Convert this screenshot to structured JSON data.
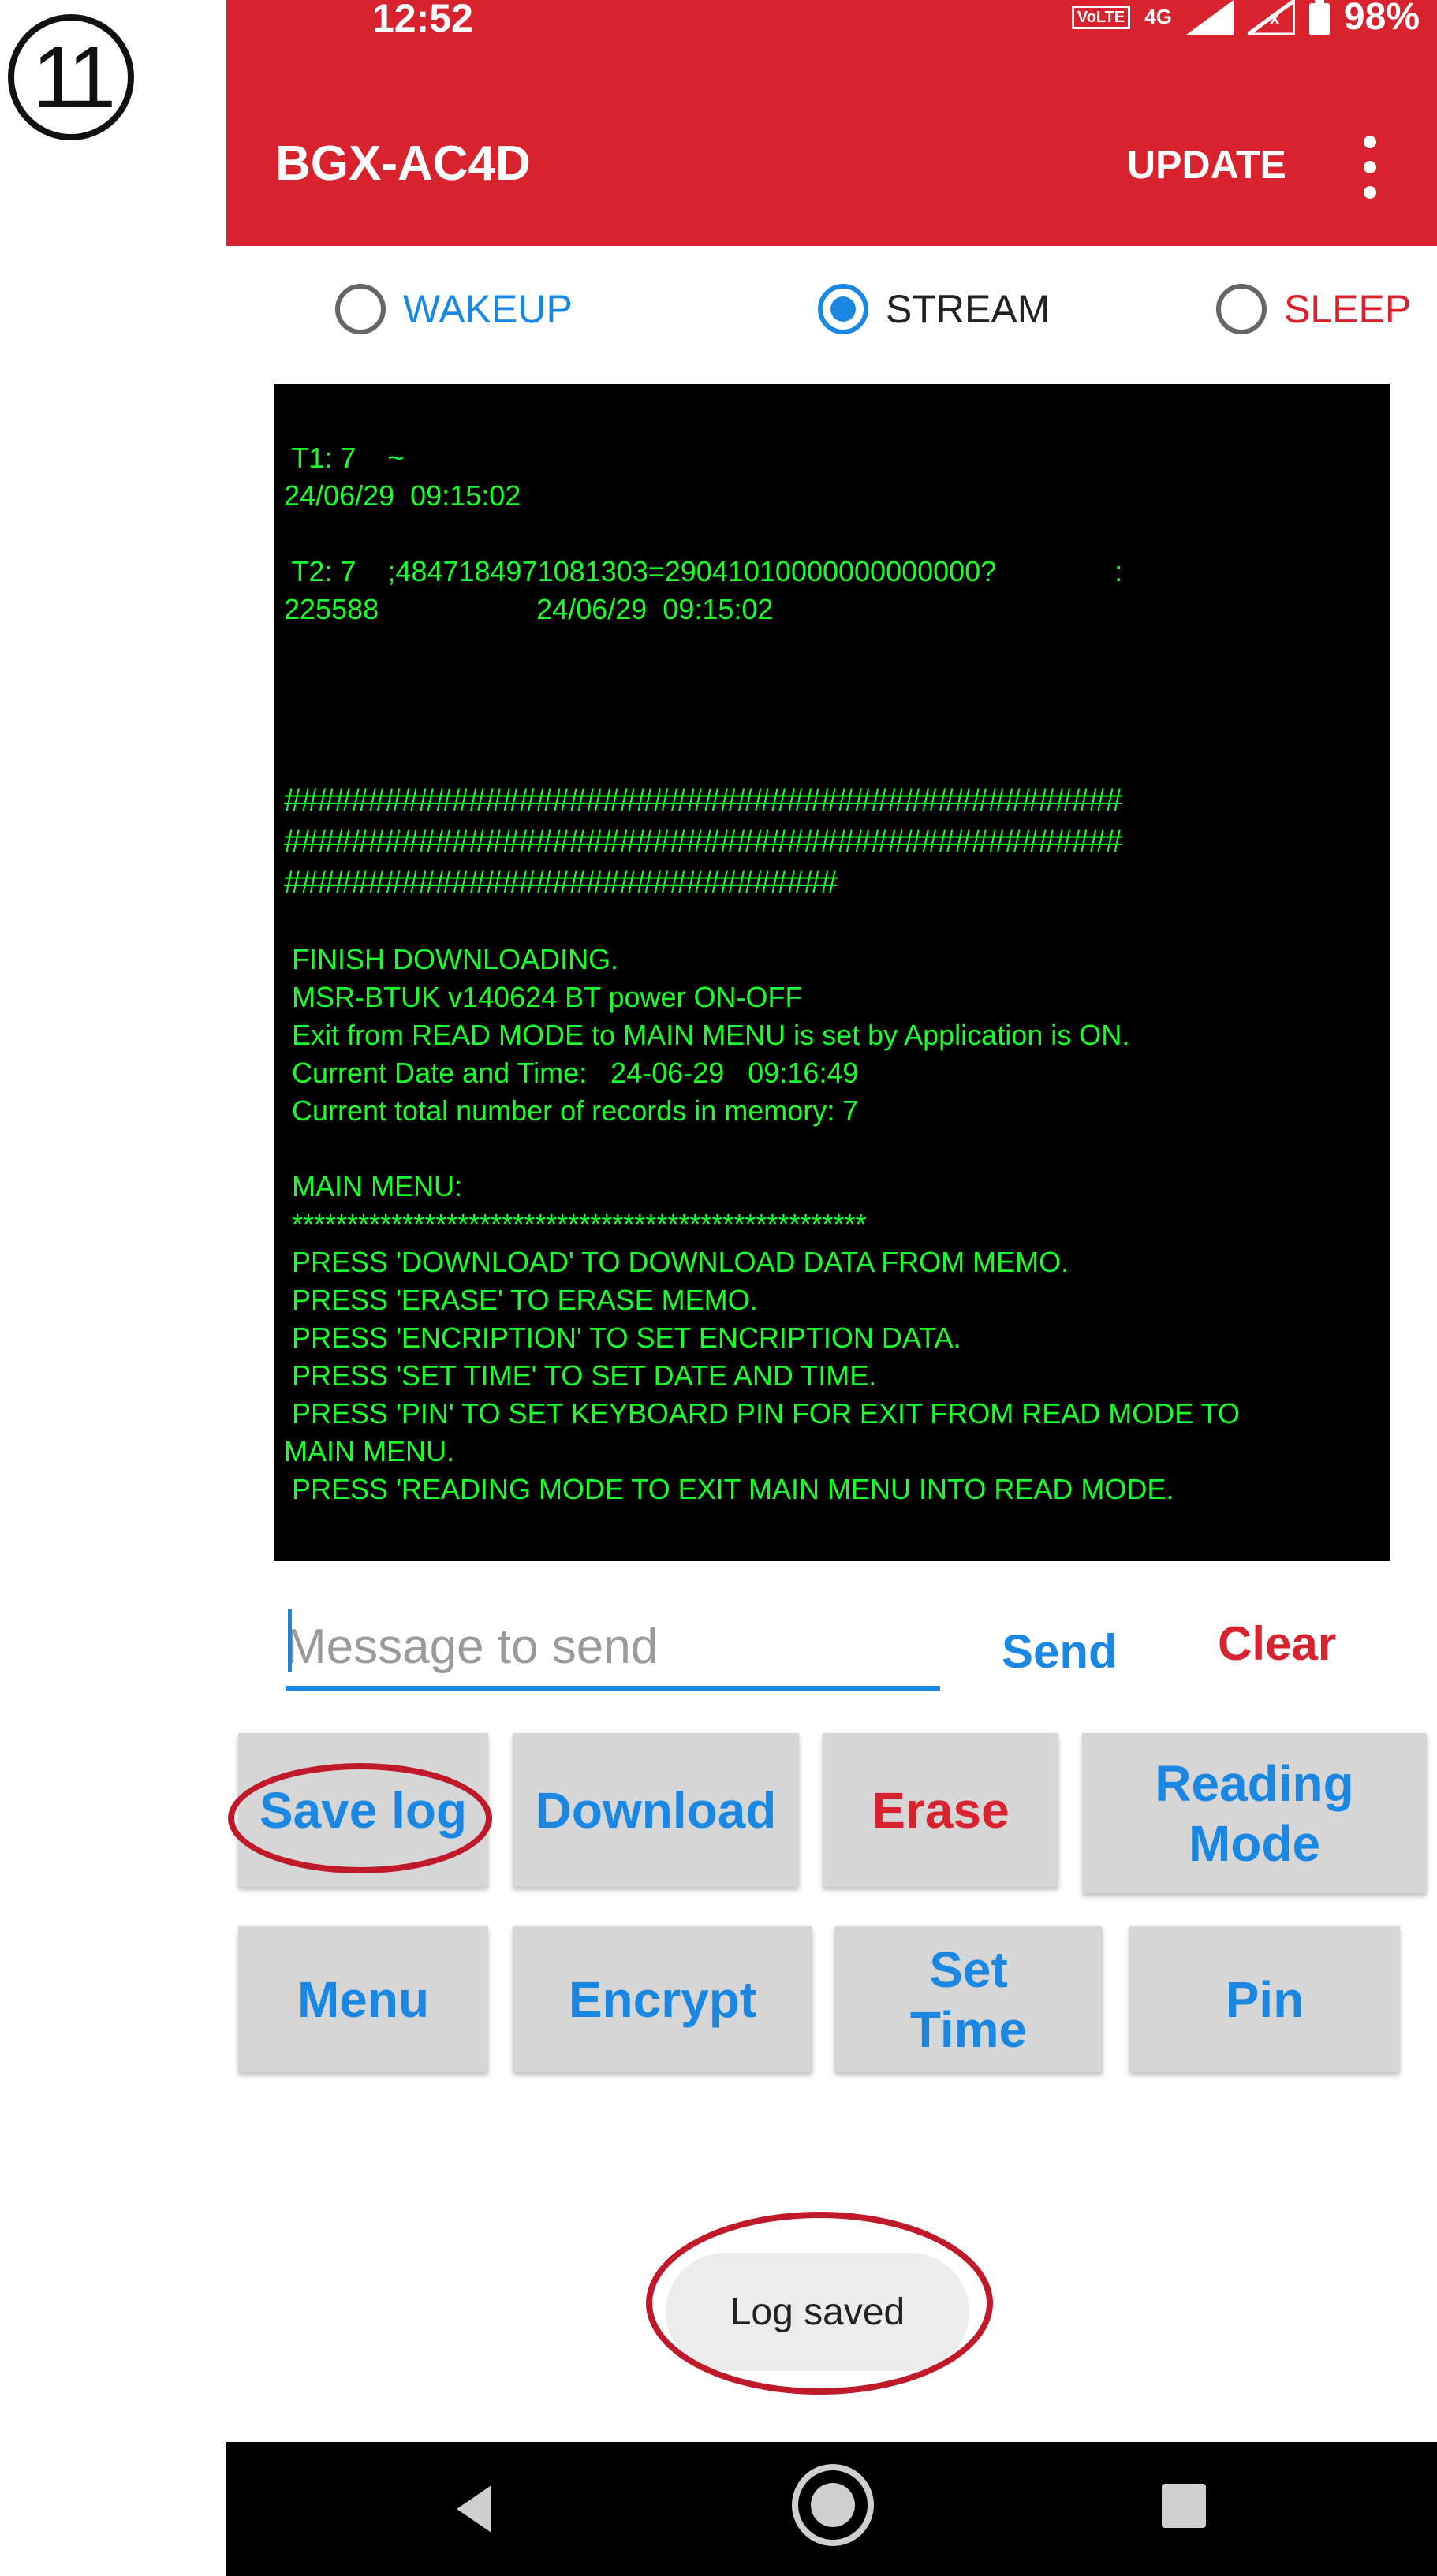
{
  "step_label": "11",
  "status_bar": {
    "time": "12:52",
    "volte": "VoLTE",
    "network": "4G",
    "battery": "98%"
  },
  "app_bar": {
    "title": "BGX-AC4D",
    "update_label": "UPDATE"
  },
  "modes": [
    {
      "label": "WAKEUP",
      "checked": false,
      "color": "#1a88e3"
    },
    {
      "label": "STREAM",
      "checked": true,
      "color": "#222222"
    },
    {
      "label": "SLEEP",
      "checked": false,
      "color": "#d8232f"
    }
  ],
  "terminal": {
    "lines": [
      " T1: 7    ~",
      "24/06/29  09:15:02",
      "",
      " T2: 7    ;4847184971081303=29041010000000000000?               :",
      "225588                    24/06/29  09:15:02",
      "",
      "",
      "",
      "",
      "##################################################",
      "##################################################",
      "#################################",
      "",
      " FINISH DOWNLOADING.",
      " MSR-BTUK v140624 BT power ON-OFF",
      " Exit from READ MODE to MAIN MENU is set by Application is ON.",
      " Current Date and Time:   24-06-29   09:16:49",
      " Current total number of records in memory: 7",
      "",
      " MAIN MENU:",
      " ****************************************************",
      " PRESS 'DOWNLOAD' TO DOWNLOAD DATA FROM MEMO.",
      " PRESS 'ERASE' TO ERASE MEMO.",
      " PRESS 'ENCRIPTION' TO SET ENCRIPTION DATA.",
      " PRESS 'SET TIME' TO SET DATE AND TIME.",
      " PRESS 'PIN' TO SET KEYBOARD PIN FOR EXIT FROM READ MODE TO",
      "MAIN MENU.",
      " PRESS 'READING MODE TO EXIT MAIN MENU INTO READ MODE."
    ]
  },
  "message": {
    "placeholder": "Message to send",
    "value": ""
  },
  "send_label": "Send",
  "clear_label": "Clear",
  "buttons_row1": [
    "Save log",
    "Download",
    "Erase",
    "Reading\nMode"
  ],
  "buttons_row2": [
    "Menu",
    "Encrypt",
    "Set\nTime",
    "Pin"
  ],
  "toast": "Log saved",
  "colors": {
    "accent": "#d8232f",
    "blue": "#1a88e3",
    "terminal_text": "#18ff2a",
    "annotation": "#c01a2a"
  },
  "nav_icons": [
    "back-icon",
    "home-icon",
    "recents-icon"
  ]
}
